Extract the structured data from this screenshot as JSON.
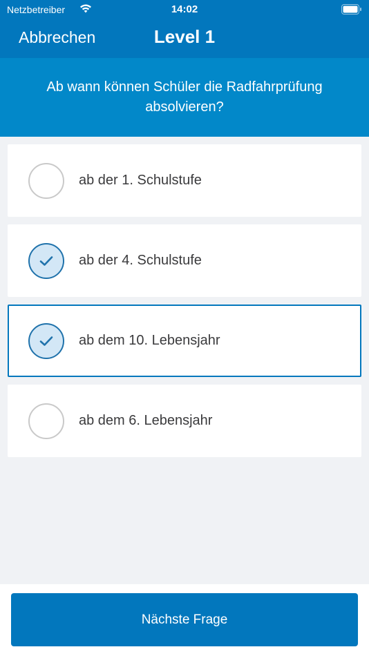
{
  "status_bar": {
    "carrier": "Netzbetreiber",
    "time": "14:02"
  },
  "nav": {
    "cancel_label": "Abbrechen",
    "title": "Level 1"
  },
  "question": {
    "text": "Ab wann können Schüler die Radfahrprüfung absolvieren?"
  },
  "answers": [
    {
      "label": "ab der 1. Schulstufe",
      "checked": false,
      "focused": false
    },
    {
      "label": "ab der 4. Schulstufe",
      "checked": true,
      "focused": false
    },
    {
      "label": "ab dem 10. Lebensjahr",
      "checked": true,
      "focused": true
    },
    {
      "label": "ab dem 6. Lebensjahr",
      "checked": false,
      "focused": false
    }
  ],
  "footer": {
    "next_label": "Nächste Frage"
  },
  "colors": {
    "primary": "#0277bd",
    "banner": "#0288c9",
    "check_fill": "#d3e7f6",
    "background": "#f0f2f5"
  }
}
